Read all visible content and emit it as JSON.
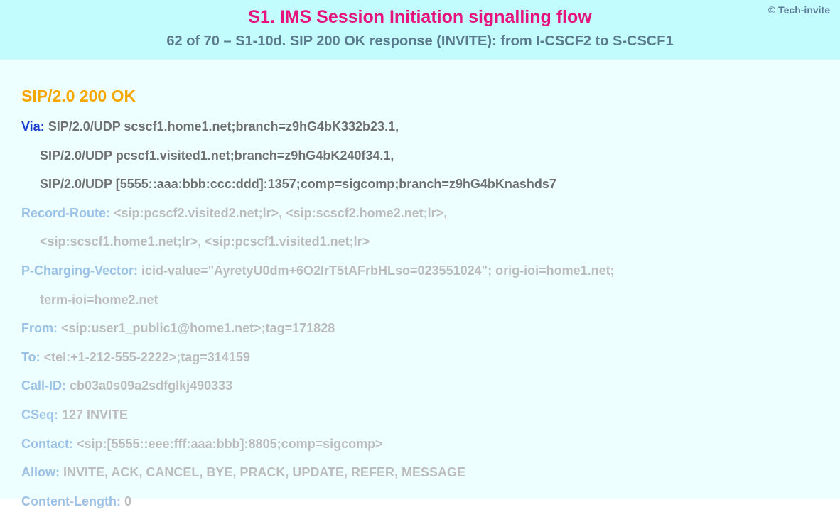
{
  "copyright": "© Tech-invite",
  "title": "S1. IMS Session Initiation signalling flow",
  "subtitle": "62 of 70 – S1-10d. SIP 200 OK response (INVITE): from I-CSCF2 to S-CSCF1",
  "status_line": "SIP/2.0 200 OK",
  "headers": {
    "via": {
      "name": "Via",
      "lines": [
        "SIP/2.0/UDP scscf1.home1.net;branch=z9hG4bK332b23.1,",
        "SIP/2.0/UDP pcscf1.visited1.net;branch=z9hG4bK240f34.1,",
        "SIP/2.0/UDP [5555::aaa:bbb:ccc:ddd]:1357;comp=sigcomp;branch=z9hG4bKnashds7"
      ]
    },
    "record_route": {
      "name": "Record-Route",
      "lines": [
        "<sip:pcscf2.visited2.net;lr>, <sip:scscf2.home2.net;lr>,",
        "<sip:scscf1.home1.net;lr>, <sip:pcscf1.visited1.net;lr>"
      ]
    },
    "p_charging_vector": {
      "name": "P-Charging-Vector",
      "lines": [
        "icid-value=\"AyretyU0dm+6O2IrT5tAFrbHLso=023551024\"; orig-ioi=home1.net;",
        "term-ioi=home2.net"
      ]
    },
    "from": {
      "name": "From",
      "value": "<sip:user1_public1@home1.net>;tag=171828"
    },
    "to": {
      "name": "To",
      "value": "<tel:+1-212-555-2222>;tag=314159"
    },
    "call_id": {
      "name": "Call-ID",
      "value": "cb03a0s09a2sdfglkj490333"
    },
    "cseq": {
      "name": "CSeq",
      "value": "127 INVITE"
    },
    "contact": {
      "name": "Contact",
      "value": "<sip:[5555::eee:fff:aaa:bbb]:8805;comp=sigcomp>"
    },
    "allow": {
      "name": "Allow",
      "value": "INVITE, ACK, CANCEL, BYE, PRACK, UPDATE, REFER, MESSAGE"
    },
    "content_length": {
      "name": "Content-Length",
      "value": "0"
    }
  }
}
